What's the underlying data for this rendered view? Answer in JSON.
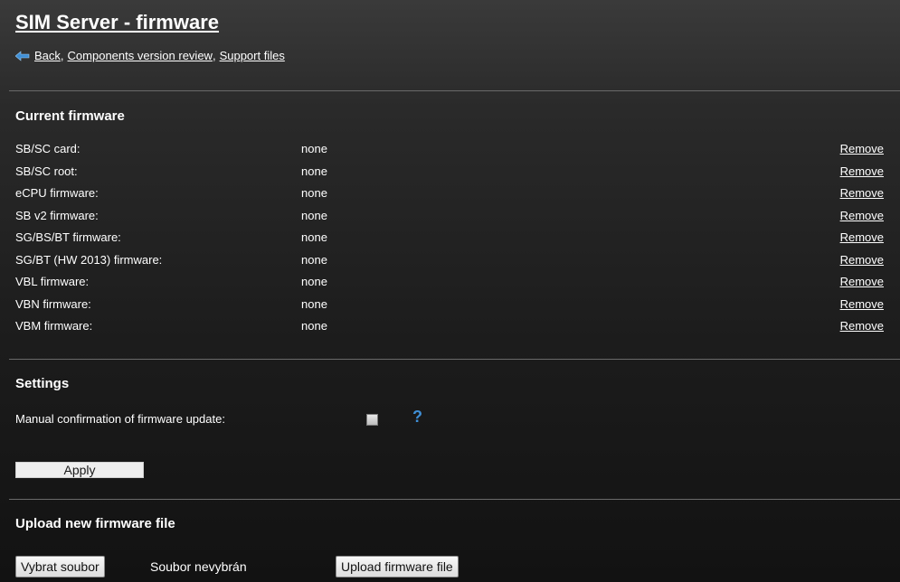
{
  "header": {
    "title": "SIM Server - firmware",
    "links": {
      "back": "Back",
      "components": "Components version review",
      "support": "Support files"
    },
    "back_icon": "back-arrow-icon"
  },
  "current_firmware": {
    "title": "Current firmware",
    "rows": [
      {
        "label": "SB/SC card:",
        "value": "none",
        "action": "Remove"
      },
      {
        "label": "SB/SC root:",
        "value": "none",
        "action": "Remove"
      },
      {
        "label": "eCPU firmware:",
        "value": "none",
        "action": "Remove"
      },
      {
        "label": "SB v2 firmware:",
        "value": "none",
        "action": "Remove"
      },
      {
        "label": "SG/BS/BT firmware:",
        "value": "none",
        "action": "Remove"
      },
      {
        "label": "SG/BT (HW 2013) firmware:",
        "value": "none",
        "action": "Remove"
      },
      {
        "label": "VBL firmware:",
        "value": "none",
        "action": "Remove"
      },
      {
        "label": "VBN firmware:",
        "value": "none",
        "action": "Remove"
      },
      {
        "label": "VBM firmware:",
        "value": "none",
        "action": "Remove"
      }
    ]
  },
  "settings": {
    "title": "Settings",
    "manual_confirmation_label": "Manual confirmation of firmware update:",
    "help": "?",
    "apply_label": "Apply"
  },
  "upload": {
    "title": "Upload new firmware file",
    "choose_label": "Vybrat soubor",
    "file_status": "Soubor nevybrán",
    "upload_label": "Upload firmware file"
  },
  "colors": {
    "background": "#1c1c1c",
    "text": "#ffffff",
    "help_accent": "#3f8fd6",
    "divider": "#6a6a6a"
  }
}
